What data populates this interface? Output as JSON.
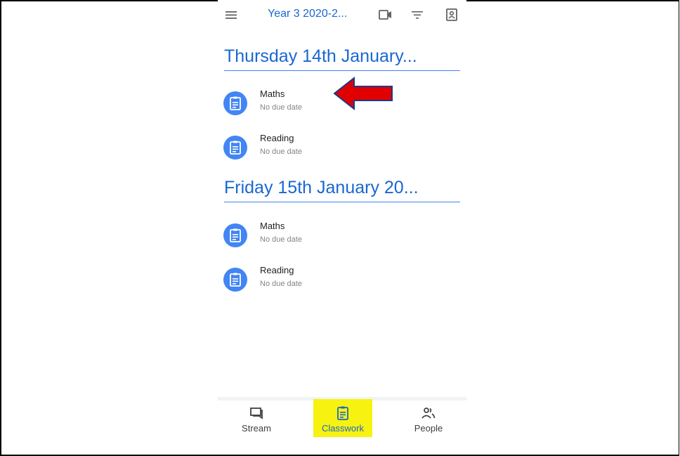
{
  "header": {
    "class_title": "Year 3 2020-2..."
  },
  "sections": [
    {
      "heading": "Thursday 14th January...",
      "items": [
        {
          "title": "Maths",
          "subtitle": "No due date"
        },
        {
          "title": "Reading",
          "subtitle": "No due date"
        }
      ]
    },
    {
      "heading": "Friday 15th January 20...",
      "items": [
        {
          "title": "Maths",
          "subtitle": "No due date"
        },
        {
          "title": "Reading",
          "subtitle": "No due date"
        }
      ]
    }
  ],
  "bottom_nav": {
    "items": [
      {
        "label": "Stream",
        "icon": "stream-icon"
      },
      {
        "label": "Classwork",
        "icon": "classwork-icon",
        "active": true,
        "highlight_color": "#f7f20f"
      },
      {
        "label": "People",
        "icon": "people-icon"
      }
    ]
  },
  "colors": {
    "accent": "#1967d2",
    "assignment_icon_bg": "#4285f4",
    "annotation_arrow": "#e00000"
  },
  "icons": {
    "topbar": [
      "menu-icon",
      "video-icon",
      "filter-icon",
      "drive-folder-icon"
    ],
    "item": "assignment-icon",
    "annotation": "red-arrow-annotation"
  }
}
